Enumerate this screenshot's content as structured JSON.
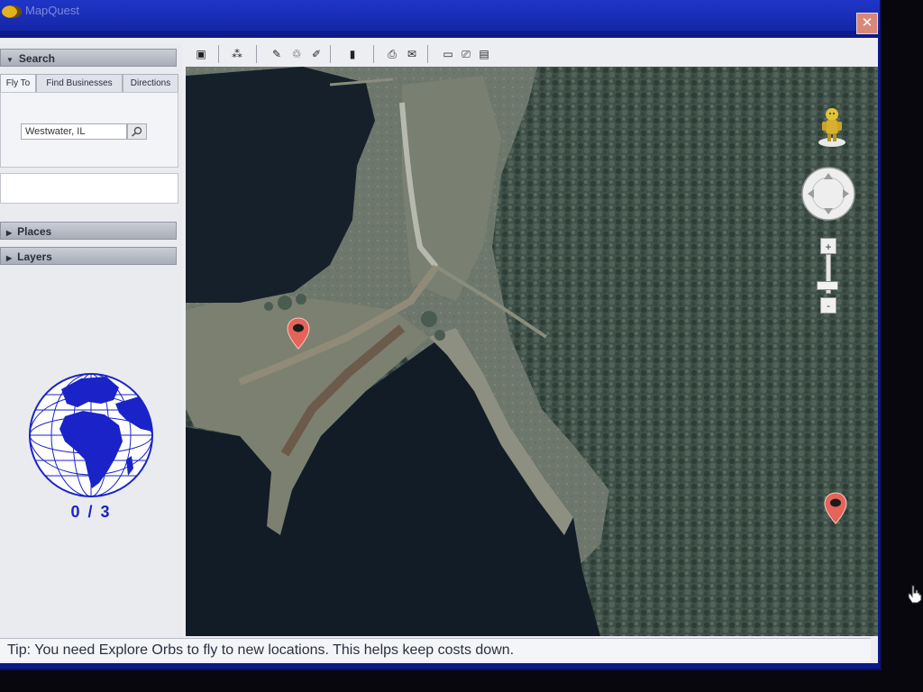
{
  "window": {
    "title": "MapQuest",
    "close_glyph": "✕"
  },
  "left_panel": {
    "search_header": "Search",
    "tabs": [
      {
        "label": "Fly To",
        "active": true
      },
      {
        "label": "Find Businesses",
        "active": false
      },
      {
        "label": "Directions",
        "active": false
      }
    ],
    "search_value": "Westwater, IL",
    "places_header": "Places",
    "layers_header": "Layers"
  },
  "orbs": {
    "counter": "0 / 3",
    "collected": 0,
    "total": 3,
    "globe_color": "#1a23c8"
  },
  "toolbar": {
    "icons": [
      "panel-toggle-icon",
      "placemark-icon",
      "ruler-icon",
      "path-icon",
      "polygon-icon",
      "measure-icon",
      "print-icon",
      "email-icon",
      "view-icon",
      "save-icon"
    ]
  },
  "map": {
    "markers": [
      {
        "name": "marker-a",
        "color": "#e4645a"
      },
      {
        "name": "marker-b",
        "color": "#e4645a"
      }
    ],
    "zoom_in_label": "+",
    "zoom_out_label": "-"
  },
  "status": {
    "tip": "Tip: You need Explore Orbs to fly to new locations. This helps keep costs down."
  },
  "colors": {
    "titlebar": "#1427a8",
    "accent_blue": "#1a23c8",
    "marker_red": "#e4645a"
  }
}
